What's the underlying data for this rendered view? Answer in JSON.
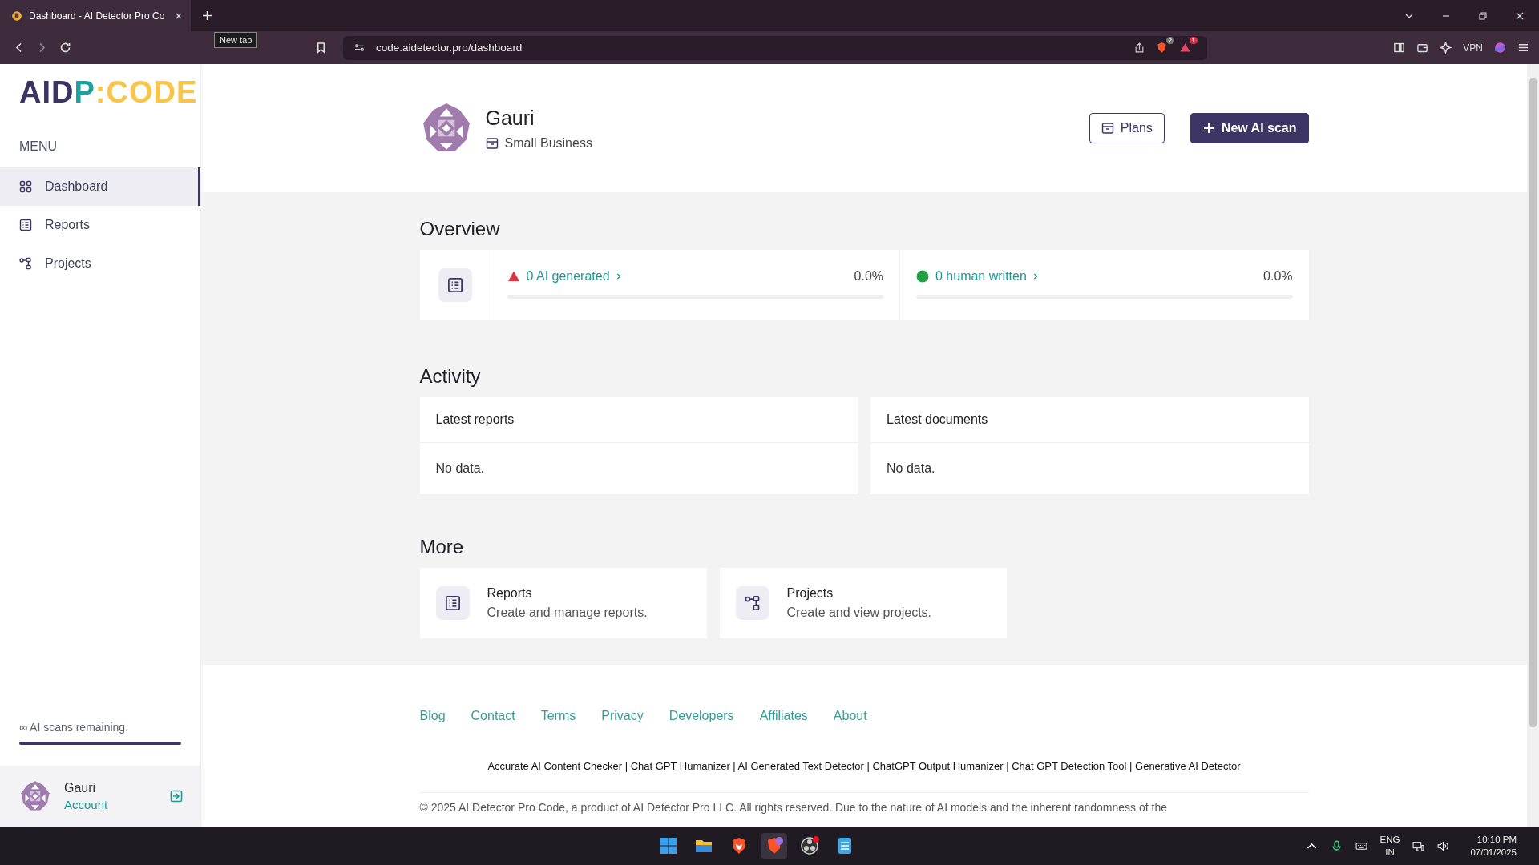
{
  "browser": {
    "tabs": [
      {
        "title": "Dashboard - AI Detector Pro Co",
        "selected": true
      }
    ],
    "new_tab_tooltip": "New tab",
    "url": "code.aidetector.pro/dashboard",
    "shield_count": "2",
    "rewards_count": "1",
    "vpn": "VPN"
  },
  "sidebar": {
    "logo": [
      {
        "text": "AID",
        "color": "#3b3363"
      },
      {
        "text": "P",
        "color": "#1aa3a0"
      },
      {
        "text": ":CODE",
        "color": "#f7c548"
      }
    ],
    "menu_title": "MENU",
    "items": [
      {
        "label": "Dashboard",
        "kind": "dashboard",
        "selected": true
      },
      {
        "label": "Reports",
        "kind": "reports",
        "selected": false
      },
      {
        "label": "Projects",
        "kind": "projects",
        "selected": false
      }
    ],
    "scans": {
      "text": "∞ AI scans remaining.",
      "level": 1
    },
    "user": {
      "name": "Gauri",
      "link": "Account"
    }
  },
  "header": {
    "name": "Gauri",
    "plan": "Small Business",
    "buttons": [
      {
        "label": "Plans",
        "kind": "outline"
      },
      {
        "label": "New AI scan",
        "kind": "primary"
      }
    ]
  },
  "overview": {
    "title": "Overview",
    "stats": [
      {
        "kind": "ai",
        "label": "0 AI generated",
        "percent": "0.0%",
        "level": 0
      },
      {
        "kind": "human",
        "label": "0 human written",
        "percent": "0.0%",
        "level": 0
      }
    ]
  },
  "activity": {
    "title": "Activity",
    "cards": [
      {
        "title": "Latest reports",
        "empty": "No data."
      },
      {
        "title": "Latest documents",
        "empty": "No data."
      }
    ]
  },
  "more": {
    "title": "More",
    "cards": [
      {
        "title": "Reports",
        "description": "Create and manage reports.",
        "kind": "reports"
      },
      {
        "title": "Projects",
        "description": "Create and view projects.",
        "kind": "projects"
      }
    ]
  },
  "footer": {
    "links": [
      "Blog",
      "Contact",
      "Terms",
      "Privacy",
      "Developers",
      "Affiliates",
      "About"
    ],
    "seo": "Accurate AI Content Checker | Chat GPT Humanizer | AI Generated Text Detector | ChatGPT Output Humanizer | Chat GPT Detection Tool | Generative AI Detector",
    "copyright": "© 2025 AI Detector Pro Code, a product of AI Detector Pro LLC. All rights reserved. Due to the nature of AI models and the inherent randomness of the"
  },
  "taskbar": {
    "lang": "ENG",
    "region": "IN",
    "time": "10:10 PM",
    "date": "07/01/2025"
  }
}
